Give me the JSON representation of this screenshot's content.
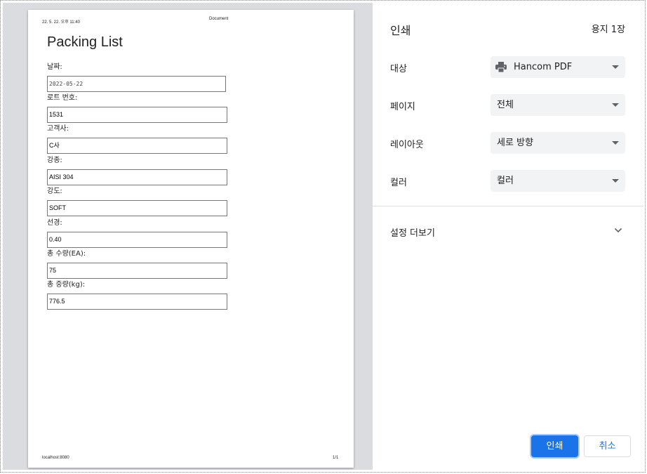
{
  "preview": {
    "header_left": "22. 5. 22. 오후 11:40",
    "header_center": "Document",
    "footer_left": "localhost:8080",
    "footer_right": "1/1",
    "doc_title": "Packing List",
    "fields": [
      {
        "label": "날짜:",
        "value": "2022-05-22"
      },
      {
        "label": "로트 번호:",
        "value": "1531"
      },
      {
        "label": "고객사:",
        "value": "C사"
      },
      {
        "label": "강종:",
        "value": "AISI 304"
      },
      {
        "label": "강도:",
        "value": "SOFT"
      },
      {
        "label": "선경:",
        "value": "0.40"
      },
      {
        "label": "총 수량(EA):",
        "value": "75"
      },
      {
        "label": "총 중량(kg):",
        "value": "776.5"
      }
    ]
  },
  "settings": {
    "title": "인쇄",
    "sheet_count": "용지 1장",
    "destination_label": "대상",
    "destination_value": "Hancom PDF",
    "pages_label": "페이지",
    "pages_value": "전체",
    "layout_label": "레이아웃",
    "layout_value": "세로 방향",
    "color_label": "컬러",
    "color_value": "컬러",
    "more_settings": "설정 더보기",
    "print_button": "인쇄",
    "cancel_button": "취소"
  },
  "icons": {
    "printer": "printer-icon",
    "dropdown": "caret-down-icon",
    "expand": "chevron-down-icon"
  },
  "colors": {
    "accent": "#1a73e8",
    "select_bg": "#f1f3f4",
    "preview_bg": "#dadce0"
  }
}
